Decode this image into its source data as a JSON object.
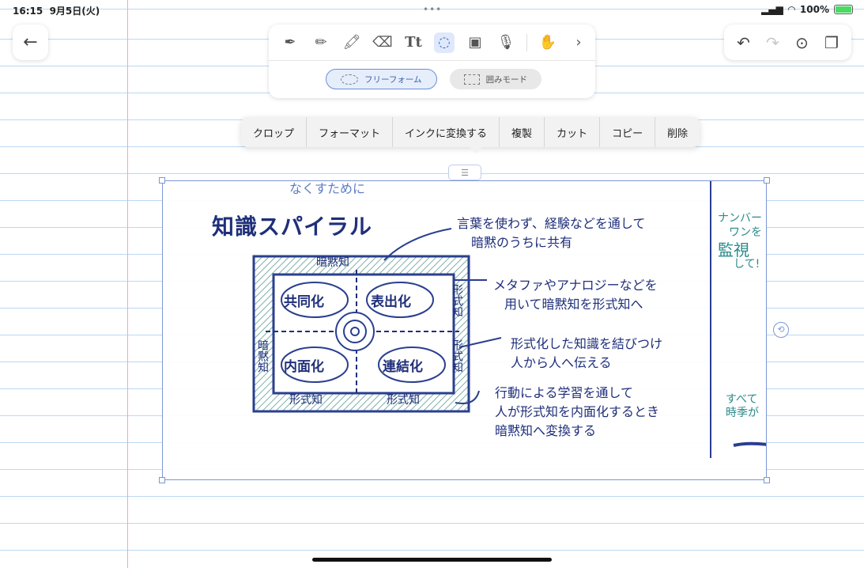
{
  "status_bar": {
    "time": "16:15",
    "date": "9月5日(火)",
    "battery": "100%"
  },
  "toolbar": {
    "tools": [
      "pen-icon",
      "pencil-icon",
      "highlighter-icon",
      "eraser-icon",
      "text-icon",
      "lasso-icon",
      "image-icon",
      "mic-icon",
      "hand-draw-icon",
      "chevron-right-icon"
    ],
    "modes": [
      {
        "label": "フリーフォーム",
        "active": true
      },
      {
        "label": "囲みモード",
        "active": false
      }
    ]
  },
  "context_menu": {
    "items": [
      "クロップ",
      "フォーマット",
      "インクに変換する",
      "複製",
      "カット",
      "コピー",
      "削除"
    ]
  },
  "note": {
    "title": "知識スパイラル",
    "top_clip": "なくすために",
    "box_top": "暗黙知",
    "quadrants": [
      "共同化",
      "表出化",
      "内面化",
      "連結化"
    ],
    "side_left": "暗黙知",
    "side_right_top": "形式知",
    "side_right_bottom": "形式知",
    "bottom_left": "形式知",
    "bottom_right": "形式知",
    "notes": [
      [
        "言葉を使わず、経験などを通して",
        "暗黙のうちに共有"
      ],
      [
        "メタファやアナロジーなどを",
        "用いて暗黙知を形式知へ"
      ],
      [
        "形式化した知識を結びつけ",
        "人から人へ伝える"
      ],
      [
        "行動による学習を通して",
        "人が形式知を内面化するとき",
        "暗黙知へ変換する"
      ]
    ],
    "right_clip": [
      "ナンバー",
      "ワンを",
      "監視",
      "して!",
      "すべて",
      "時季が"
    ]
  }
}
